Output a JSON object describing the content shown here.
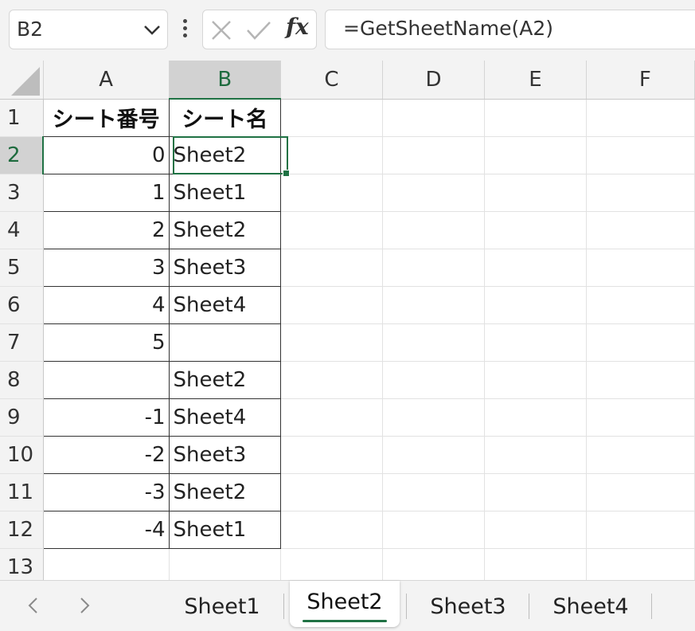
{
  "name_box": {
    "value": "B2"
  },
  "formula": {
    "text": "=GetSheetName(A2)"
  },
  "function_icon": "fx",
  "columns": [
    "A",
    "B",
    "C",
    "D",
    "E",
    "F"
  ],
  "selected": {
    "column": "B",
    "row": "2"
  },
  "rows": [
    {
      "num": "1",
      "a": "シート番号",
      "b": "シート名"
    },
    {
      "num": "2",
      "a": "0",
      "b": "Sheet2"
    },
    {
      "num": "3",
      "a": "1",
      "b": "Sheet1"
    },
    {
      "num": "4",
      "a": "2",
      "b": "Sheet2"
    },
    {
      "num": "5",
      "a": "3",
      "b": "Sheet3"
    },
    {
      "num": "6",
      "a": "4",
      "b": "Sheet4"
    },
    {
      "num": "7",
      "a": "5",
      "b": ""
    },
    {
      "num": "8",
      "a": "",
      "b": "Sheet2"
    },
    {
      "num": "9",
      "a": "-1",
      "b": "Sheet4"
    },
    {
      "num": "10",
      "a": "-2",
      "b": "Sheet3"
    },
    {
      "num": "11",
      "a": "-3",
      "b": "Sheet2"
    },
    {
      "num": "12",
      "a": "-4",
      "b": "Sheet1"
    },
    {
      "num": "13",
      "a": "",
      "b": ""
    }
  ],
  "sheet_tabs": [
    {
      "label": "Sheet1",
      "active": false
    },
    {
      "label": "Sheet2",
      "active": true
    },
    {
      "label": "Sheet3",
      "active": false
    },
    {
      "label": "Sheet4",
      "active": false
    }
  ],
  "colors": {
    "accent": "#1f7244",
    "header_bg": "#f3f3f3",
    "selected_header_bg": "#d2d2d2"
  }
}
